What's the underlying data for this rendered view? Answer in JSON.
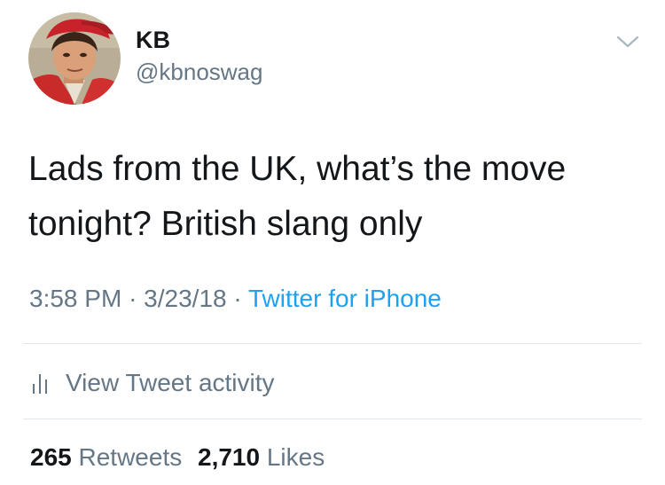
{
  "author": {
    "display_name": "KB",
    "handle": "@kbnoswag"
  },
  "tweet": {
    "text": "Lads from the UK, what’s the move tonight? British slang only",
    "time": "3:58 PM",
    "date": "3/23/18",
    "separator": "·",
    "source": "Twitter for iPhone"
  },
  "activity": {
    "label": "View Tweet activity",
    "icon": "bar-chart-icon"
  },
  "stats": {
    "retweets_count": "265",
    "retweets_label": "Retweets",
    "likes_count": "2,710",
    "likes_label": "Likes"
  },
  "colors": {
    "text": "#14171a",
    "secondary": "#657786",
    "link": "#1da1f2",
    "divider": "#e1e8ed"
  }
}
